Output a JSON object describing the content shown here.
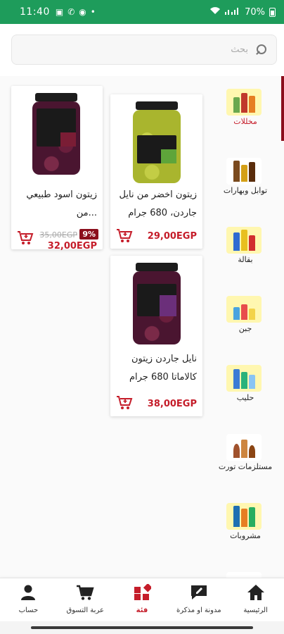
{
  "status_bar": {
    "time": "11:40",
    "battery": "70%"
  },
  "search": {
    "placeholder": "بحث"
  },
  "colors": {
    "brand_green": "#1e9c5b",
    "accent_red": "#c51d2a",
    "discount_bg": "#8b0e1c"
  },
  "categories": [
    {
      "label": "مخللات",
      "icon": "pickles-icon",
      "active": true
    },
    {
      "label": "توابل وبهارات",
      "icon": "spices-icon",
      "active": false
    },
    {
      "label": "بقالة",
      "icon": "grocery-icon",
      "active": false
    },
    {
      "label": "جبن",
      "icon": "cheese-icon",
      "active": false
    },
    {
      "label": "حليب",
      "icon": "milk-icon",
      "active": false
    },
    {
      "label": "مستلزمات تورت",
      "icon": "cake-supplies-icon",
      "active": false
    },
    {
      "label": "مشروبات",
      "icon": "drinks-icon",
      "active": false
    }
  ],
  "products": [
    {
      "name": "زيتون اخضر من نايل جاردن، 680 جرام",
      "price": "29,00EGP"
    },
    {
      "name": "زيتون اسود طبيعي ...من",
      "price": "32,00EGP",
      "old_price": "35,00EGP",
      "discount": "9%"
    },
    {
      "name": "نايل جاردن زيتون كالاماتا 680 جرام",
      "price": "38,00EGP"
    }
  ],
  "bottom_nav": [
    {
      "label": "الرئيسية",
      "icon": "home-icon"
    },
    {
      "label": "مدونة او مذكرة",
      "icon": "notes-icon"
    },
    {
      "label": "فئة",
      "icon": "category-icon",
      "active": true
    },
    {
      "label": "عربة التسوق",
      "icon": "cart-icon"
    },
    {
      "label": "حساب",
      "icon": "account-icon"
    }
  ]
}
